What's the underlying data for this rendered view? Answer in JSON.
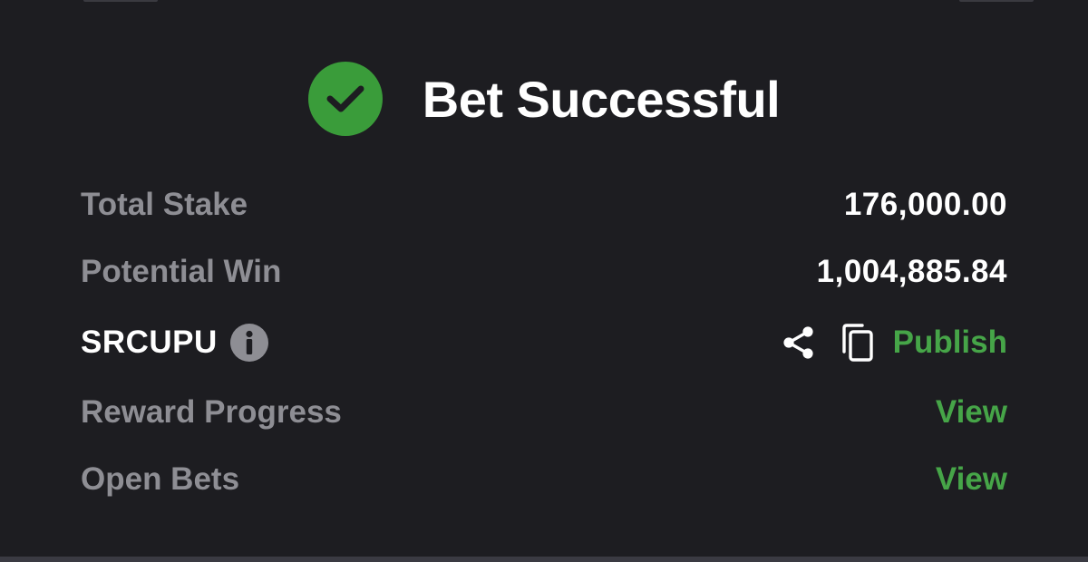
{
  "header": {
    "title": "Bet Successful",
    "icon": "check-circle-icon",
    "accent_color": "#3a9c3a"
  },
  "summary": {
    "total_stake_label": "Total Stake",
    "total_stake_value": "176,000.00",
    "potential_win_label": "Potential Win",
    "potential_win_value": "1,004,885.84"
  },
  "booking": {
    "code": "SRCUPU",
    "info_icon": "info-icon",
    "share_icon": "share-icon",
    "copy_icon": "copy-icon",
    "publish_label": "Publish"
  },
  "links": {
    "reward_progress_label": "Reward Progress",
    "reward_progress_action": "View",
    "open_bets_label": "Open Bets",
    "open_bets_action": "View"
  },
  "colors": {
    "background": "#1d1d21",
    "label_grey": "#8e8e94",
    "link_green": "#46a548"
  }
}
